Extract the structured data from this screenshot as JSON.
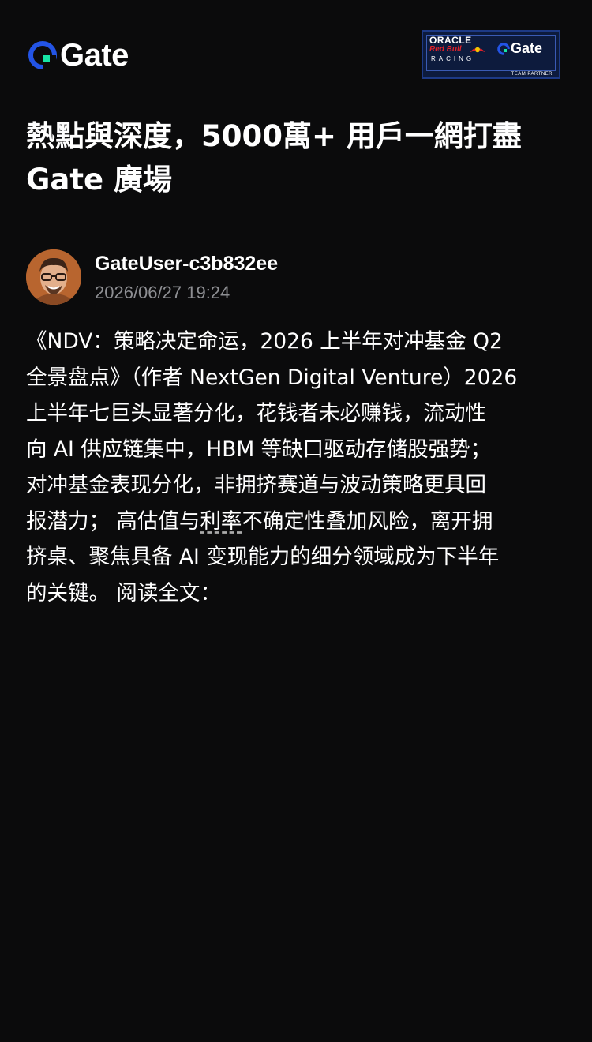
{
  "header": {
    "logo_text": "Gate",
    "logo_icon": "gate-logo-icon",
    "partner_badge": {
      "oracle": "ORACLE",
      "redbull": "Red Bull",
      "racing": "RACING",
      "gate": "Gate",
      "team_partner": "TEAM PARTNER"
    }
  },
  "headline": {
    "line1": "熱點與深度，5000萬+ 用戶一網打盡",
    "line2": "Gate 廣場"
  },
  "author": {
    "name": "GateUser-c3b832ee",
    "timestamp": "2026/06/27 19:24",
    "avatar_icon": "user-avatar"
  },
  "post": {
    "lines": [
      "《NDV：策略决定命运，2026 上半年对冲基金 Q2",
      "全景盘点》（作者 NextGen Digital Venture）2026",
      "上半年七巨头显著分化，花钱者未必赚钱，流动性",
      "向 AI 供应链集中，HBM  等缺口驱动存储股强势；",
      "对冲基金表现分化，非拥挤赛道与波动策略更具回"
    ],
    "line6_before": "报潜力；  高估值与",
    "line6_underlined": "利率",
    "line6_after": "不确定性叠加风险，离开拥",
    "line7": "挤桌、聚焦具备 AI 变现能力的细分领域成为下半年",
    "line8": "的关键。 阅读全文："
  },
  "colors": {
    "background": "#0b0b0c",
    "text": "#ffffff",
    "muted": "#8e8f93",
    "brand_blue": "#2354e6",
    "brand_cyan": "#17e5a5"
  }
}
